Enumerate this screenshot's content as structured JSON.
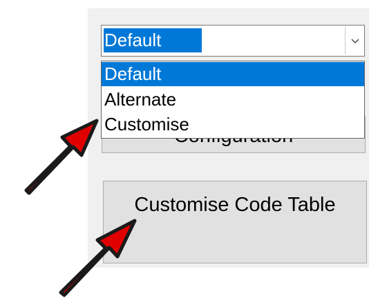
{
  "combo": {
    "selected_value": "Default",
    "options": [
      {
        "label": "Default",
        "selected": true
      },
      {
        "label": "Alternate",
        "selected": false
      },
      {
        "label": "Customise",
        "selected": false
      }
    ],
    "arrow_icon": "chevron-down-icon"
  },
  "buttons": {
    "configuration_label": "Configuration",
    "customise_code_table_label": "Customise Code Table"
  },
  "annotations": {
    "arrow_color": "#e00000",
    "arrow_outline": "#1a1a1a"
  },
  "colors": {
    "selection": "#0078d7",
    "panel_bg": "#f0f0f0",
    "button_bg": "#e1e1e1"
  }
}
